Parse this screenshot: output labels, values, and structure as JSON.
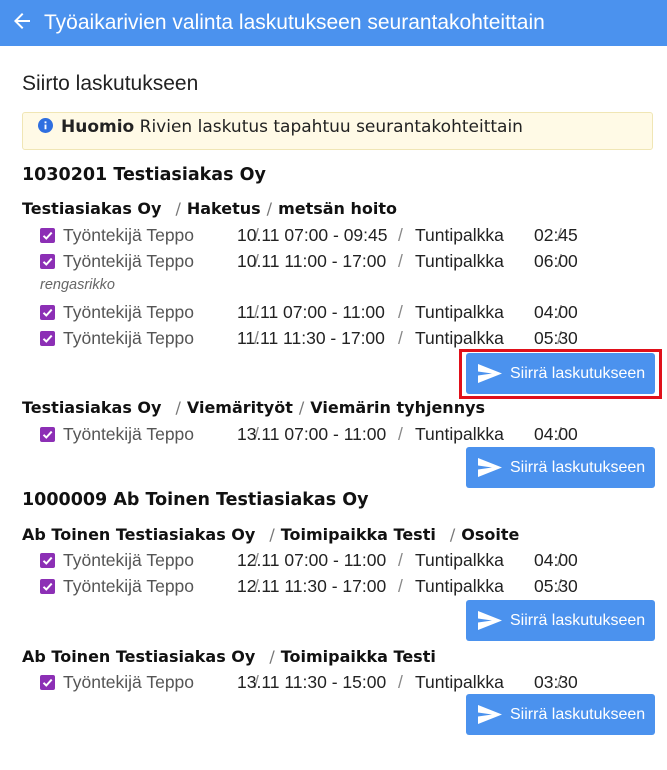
{
  "header": {
    "title": "Työaikarivien valinta laskutukseen seurantakohteittain",
    "back_icon": "arrow-left-icon"
  },
  "page": {
    "title": "Siirto laskutukseen"
  },
  "notice": {
    "title": "Huomio",
    "text": "Rivien laskutus tapahtuu seurantakohteittain",
    "icon": "info-icon"
  },
  "transfer_button_label": "Siirrä laskutukseen",
  "accent_color": "#4b92ee",
  "checkbox_color": "#8c2fb5",
  "highlight_color": "#e0101a",
  "customers": [
    {
      "name": "1030201 Testiasiakas Oy",
      "groups": [
        {
          "path": [
            "Testiasiakas Oy",
            "Haketus",
            "metsän hoito"
          ],
          "rows": [
            {
              "employee": "Työntekijä Teppo",
              "time": "10.11 07:00 - 09:45",
              "pay": "Tuntipalkka",
              "duration": "02:45",
              "checked": true
            },
            {
              "employee": "Työntekijä Teppo",
              "time": "10.11 11:00 - 17:00",
              "pay": "Tuntipalkka",
              "duration": "06:00",
              "checked": true
            },
            {
              "note": "rengasrikko"
            },
            {
              "employee": "Työntekijä Teppo",
              "time": "11.11 07:00 - 11:00",
              "pay": "Tuntipalkka",
              "duration": "04:00",
              "checked": true
            },
            {
              "employee": "Työntekijä Teppo",
              "time": "11.11 11:30 - 17:00",
              "pay": "Tuntipalkka",
              "duration": "05:30",
              "checked": true
            }
          ]
        },
        {
          "path": [
            "Testiasiakas Oy",
            "Viemärityöt",
            "Viemärin tyhjennys"
          ],
          "rows": [
            {
              "employee": "Työntekijä Teppo",
              "time": "13.11 07:00 - 11:00",
              "pay": "Tuntipalkka",
              "duration": "04:00",
              "checked": true
            }
          ]
        }
      ]
    },
    {
      "name": "1000009 Ab Toinen Testiasiakas Oy",
      "groups": [
        {
          "path": [
            "Ab Toinen Testiasiakas Oy",
            "Toimipaikka Testi",
            "Osoite"
          ],
          "rows": [
            {
              "employee": "Työntekijä Teppo",
              "time": "12.11 07:00 - 11:00",
              "pay": "Tuntipalkka",
              "duration": "04:00",
              "checked": true
            },
            {
              "employee": "Työntekijä Teppo",
              "time": "12.11 11:30 - 17:00",
              "pay": "Tuntipalkka",
              "duration": "05:30",
              "checked": true
            }
          ]
        },
        {
          "path": [
            "Ab Toinen Testiasiakas Oy",
            "Toimipaikka Testi"
          ],
          "rows": [
            {
              "employee": "Työntekijä Teppo",
              "time": "13.11 11:30 - 15:00",
              "pay": "Tuntipalkka",
              "duration": "03:30",
              "checked": true
            }
          ]
        }
      ]
    }
  ]
}
